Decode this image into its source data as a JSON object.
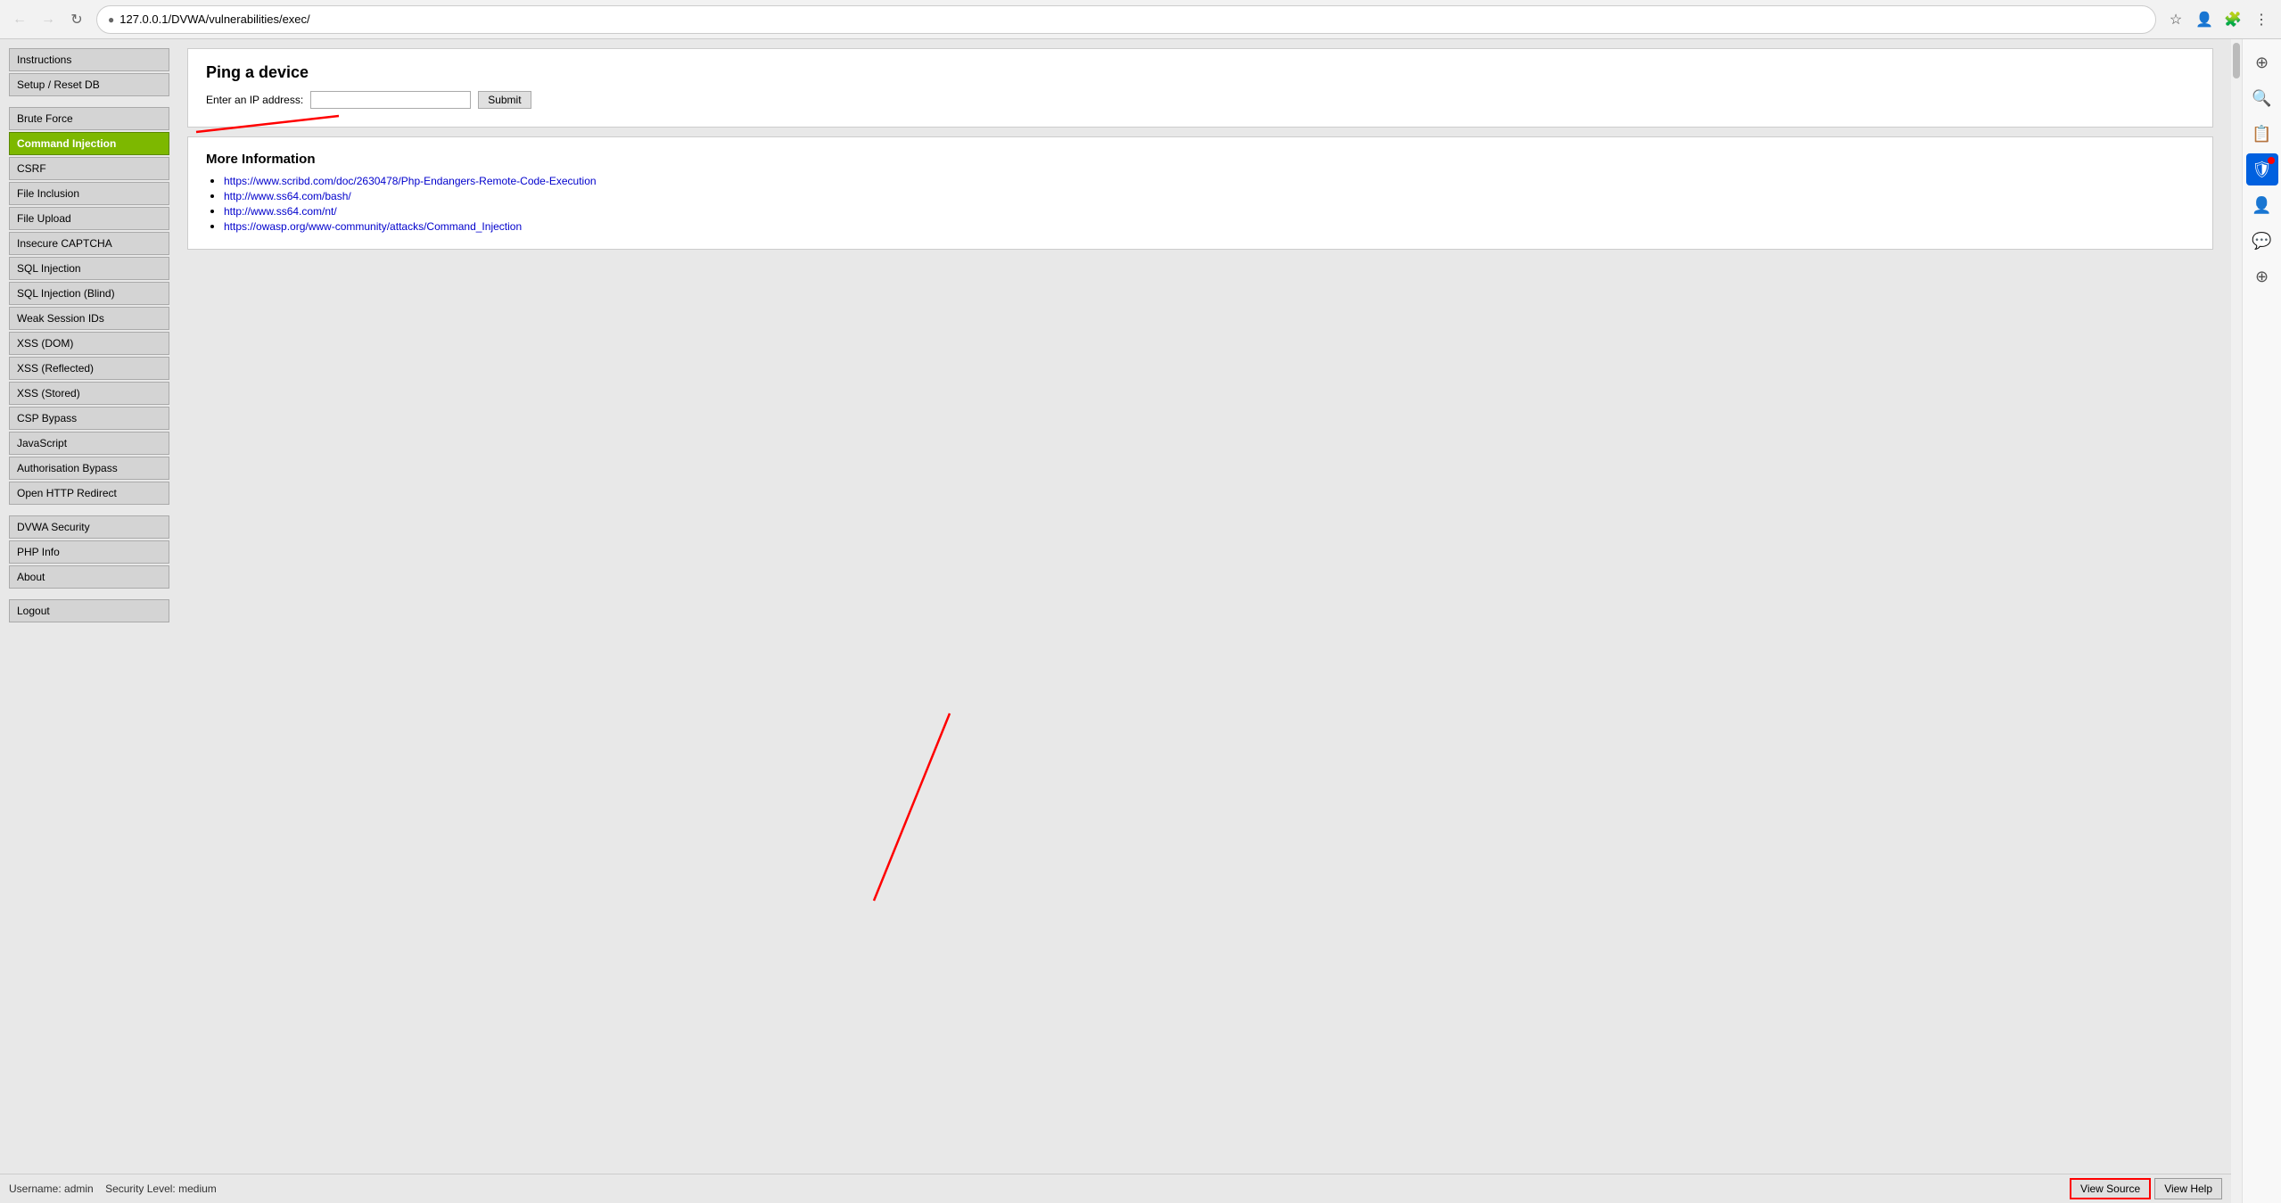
{
  "browser": {
    "url": "127.0.0.1/DVWA/vulnerabilities/exec/",
    "back_btn": "←",
    "forward_btn": "→",
    "reload_btn": "↺"
  },
  "nav": {
    "items": [
      {
        "id": "instructions",
        "label": "Instructions",
        "active": false
      },
      {
        "id": "setup-reset",
        "label": "Setup / Reset DB",
        "active": false
      },
      {
        "id": "brute-force",
        "label": "Brute Force",
        "active": false
      },
      {
        "id": "command-injection",
        "label": "Command Injection",
        "active": true
      },
      {
        "id": "csrf",
        "label": "CSRF",
        "active": false
      },
      {
        "id": "file-inclusion",
        "label": "File Inclusion",
        "active": false
      },
      {
        "id": "file-upload",
        "label": "File Upload",
        "active": false
      },
      {
        "id": "insecure-captcha",
        "label": "Insecure CAPTCHA",
        "active": false
      },
      {
        "id": "sql-injection",
        "label": "SQL Injection",
        "active": false
      },
      {
        "id": "sql-injection-blind",
        "label": "SQL Injection (Blind)",
        "active": false
      },
      {
        "id": "weak-session-ids",
        "label": "Weak Session IDs",
        "active": false
      },
      {
        "id": "xss-dom",
        "label": "XSS (DOM)",
        "active": false
      },
      {
        "id": "xss-reflected",
        "label": "XSS (Reflected)",
        "active": false
      },
      {
        "id": "xss-stored",
        "label": "XSS (Stored)",
        "active": false
      },
      {
        "id": "csp-bypass",
        "label": "CSP Bypass",
        "active": false
      },
      {
        "id": "javascript",
        "label": "JavaScript",
        "active": false
      },
      {
        "id": "authorisation-bypass",
        "label": "Authorisation Bypass",
        "active": false
      },
      {
        "id": "open-http-redirect",
        "label": "Open HTTP Redirect",
        "active": false
      }
    ],
    "section2": [
      {
        "id": "dvwa-security",
        "label": "DVWA Security",
        "active": false
      },
      {
        "id": "php-info",
        "label": "PHP Info",
        "active": false
      },
      {
        "id": "about",
        "label": "About",
        "active": false
      }
    ],
    "logout": "Logout"
  },
  "main": {
    "title": "Ping a device",
    "ping_label": "Enter an IP address:",
    "submit_label": "Submit",
    "more_info_title": "More Information",
    "links": [
      {
        "url": "https://www.scribd.com/doc/2630478/Php-Endangers-Remote-Code-Execution",
        "text": "https://www.scribd.com/doc/2630478/Php-Endangers-Remote-Code-Execution"
      },
      {
        "url": "http://www.ss64.com/bash/",
        "text": "http://www.ss64.com/bash/"
      },
      {
        "url": "http://www.ss64.com/nt/",
        "text": "http://www.ss64.com/nt/"
      },
      {
        "url": "https://owasp.org/www-community/attacks/Command_Injection",
        "text": "https://owasp.org/www-community/attacks/Command_Injection"
      }
    ]
  },
  "bottom": {
    "username_label": "Username:",
    "username": "admin",
    "security_label": "Security Level:",
    "security": "medium",
    "view_source_label": "View Source",
    "view_help_label": "View Help"
  }
}
